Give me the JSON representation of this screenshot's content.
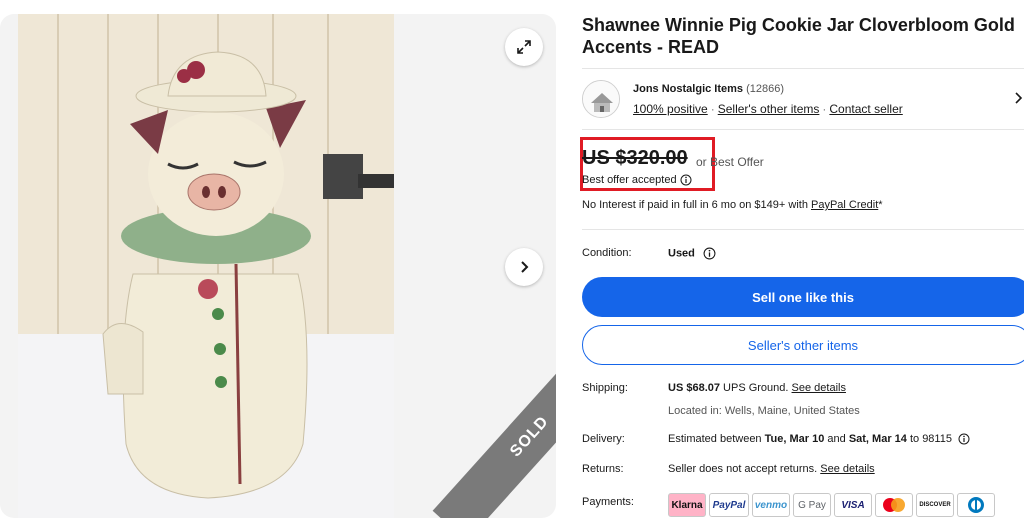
{
  "listing": {
    "title": "Shawnee Winnie Pig Cookie Jar Cloverbloom Gold Accents - READ",
    "sold_label": "SOLD"
  },
  "seller": {
    "name": "Jons Nostalgic Items",
    "feedback_count": "(12866)",
    "positive": "100% positive",
    "other_items": "Seller's other items",
    "contact": "Contact seller"
  },
  "price": {
    "amount": "US $320.00",
    "or_best_offer": "or Best Offer",
    "accepted": "Best offer accepted",
    "financing_prefix": "No Interest if paid in full in 6 mo on $149+ with ",
    "financing_link": "PayPal Credit",
    "financing_suffix": "*"
  },
  "condition": {
    "label": "Condition:",
    "value": "Used"
  },
  "buttons": {
    "sell_one": "Sell one like this",
    "sellers_other": "Seller's other items"
  },
  "shipping": {
    "label": "Shipping:",
    "amount": "US $68.07",
    "method": " UPS Ground. ",
    "details_link": "See details",
    "location": "Located in: Wells, Maine, United States"
  },
  "delivery": {
    "label": "Delivery:",
    "prefix": "Estimated between ",
    "start": "Tue, Mar 10",
    "and": " and ",
    "end": "Sat, Mar 14",
    "to": " to 98115"
  },
  "returns": {
    "label": "Returns:",
    "text": "Seller does not accept returns. ",
    "link": "See details"
  },
  "payments": {
    "label": "Payments:",
    "methods": [
      "Klarna",
      "PayPal",
      "venmo",
      "G Pay",
      "VISA",
      "Mastercard",
      "DISCOVER",
      "Diners"
    ]
  },
  "colors": {
    "accent": "#1565e9",
    "highlight": "#e01b24"
  }
}
